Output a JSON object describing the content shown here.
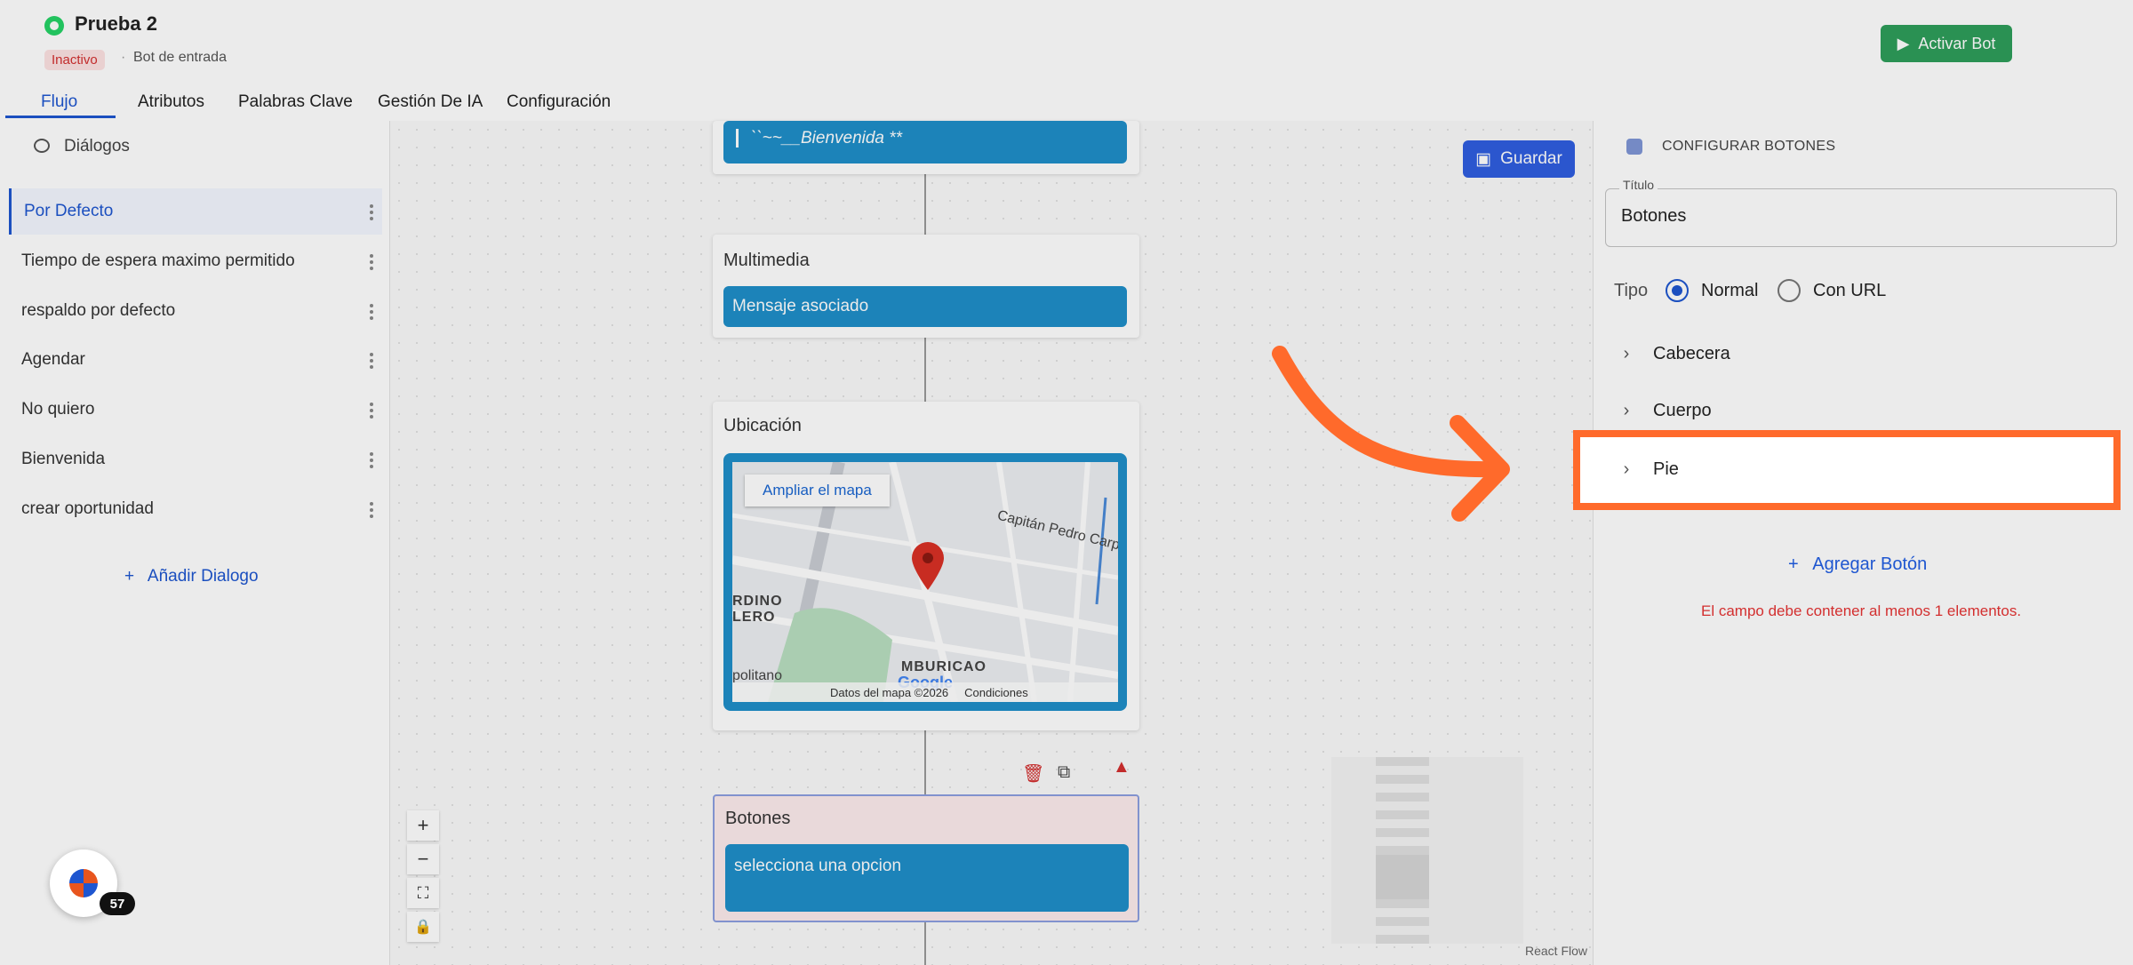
{
  "header": {
    "title": "Prueba 2",
    "status_badge": "Inactivo",
    "separator": "·",
    "subtitle": "Bot de entrada",
    "activate_label": "Activar Bot"
  },
  "tabs": [
    {
      "label": "Flujo",
      "active": true
    },
    {
      "label": "Atributos"
    },
    {
      "label": "Palabras Clave"
    },
    {
      "label": "Gestión De IA"
    },
    {
      "label": "Configuración"
    }
  ],
  "sidebar": {
    "title": "Diálogos",
    "items": [
      {
        "label": "Por Defecto",
        "active": true
      },
      {
        "label": "Tiempo de espera maximo permitido"
      },
      {
        "label": "respaldo por defecto"
      },
      {
        "label": "Agendar"
      },
      {
        "label": "No quiero"
      },
      {
        "label": "Bienvenida"
      },
      {
        "label": "crear oportunidad"
      }
    ],
    "add_label": "Añadir Dialogo",
    "launcher_count": "57"
  },
  "canvas": {
    "save_label": "Guardar",
    "top_node_msg": "``~~__Bienvenida **",
    "multimedia_label": "Multimedia",
    "multimedia_msg": "Mensaje asociado",
    "ubicacion_label": "Ubicación",
    "map": {
      "enlarge": "Ampliar el mapa",
      "street": "Capitán Pedro Carpin",
      "area1": "RDINO",
      "area2": "LERO",
      "area3": "MBURICAO",
      "area4": "politano",
      "google": "Google",
      "map_data": "Datos del mapa ©2026",
      "terms": "Condiciones"
    },
    "botones_label": "Botones",
    "botones_msg": "selecciona una opcion",
    "react_flow": "React Flow"
  },
  "panel": {
    "title": "CONFIGURAR BOTONES",
    "field_label": "Título",
    "field_value": "Botones",
    "tipo_label": "Tipo",
    "option_normal": "Normal",
    "option_url": "Con URL",
    "selected": "Normal",
    "sections": [
      "Cabecera",
      "Cuerpo",
      "Pie"
    ],
    "add_button": "Agregar Botón",
    "error": "El campo debe contener al menos 1 elementos."
  },
  "colors": {
    "accent": "#1e56d0",
    "node_blue": "#1f8fc9",
    "highlight": "#ff6a2b",
    "success": "#2e9e5b",
    "error": "#d32f2f"
  }
}
